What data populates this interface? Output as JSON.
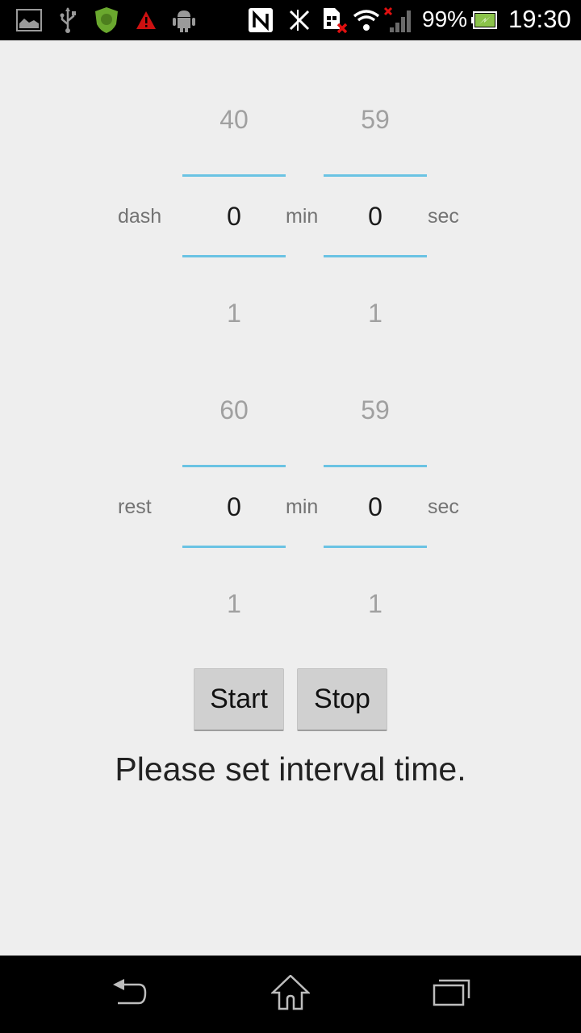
{
  "status_bar": {
    "icons": [
      "gallery-icon",
      "usb-icon",
      "antivirus-shield-icon",
      "warning-icon",
      "android-icon",
      "nfc-icon",
      "bluetooth-off-icon",
      "sim-missing-icon",
      "wifi-icon",
      "signal-no-service-icon",
      "battery-charging-icon"
    ],
    "battery_percent": "99%",
    "time": "19:30",
    "colors": {
      "shield": "#6aa82e",
      "warning": "#cc1111",
      "battery_fill": "#8bc34a"
    }
  },
  "pickers": [
    {
      "label": "dash",
      "minutes": {
        "prev": "40",
        "current": "0",
        "next": "1",
        "unit": "min"
      },
      "seconds": {
        "prev": "59",
        "current": "0",
        "next": "1",
        "unit": "sec"
      }
    },
    {
      "label": "rest",
      "minutes": {
        "prev": "60",
        "current": "0",
        "next": "1",
        "unit": "min"
      },
      "seconds": {
        "prev": "59",
        "current": "0",
        "next": "1",
        "unit": "sec"
      }
    }
  ],
  "buttons": {
    "start": "Start",
    "stop": "Stop"
  },
  "status_message": "Please set interval time.",
  "nav_bar": {
    "icons": [
      "back-icon",
      "home-icon",
      "recent-apps-icon"
    ]
  },
  "accent_color": "#6ac3e3"
}
